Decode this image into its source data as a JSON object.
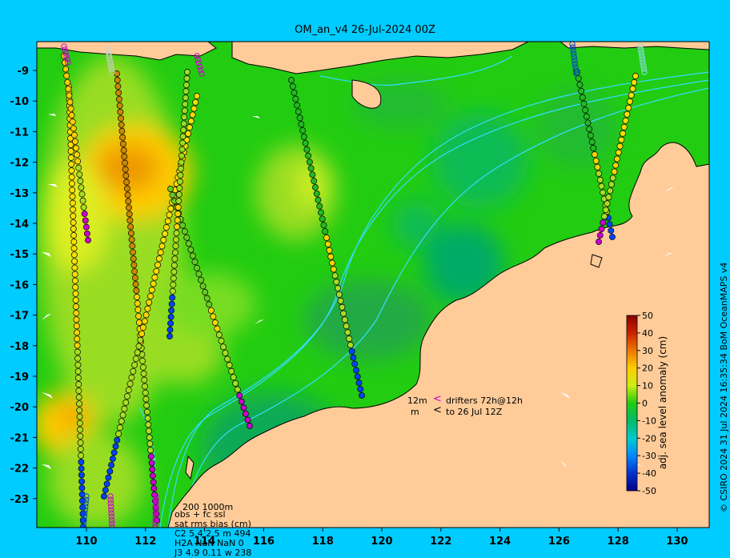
{
  "title": "OM_an_v4  26-Jul-2024 00Z",
  "side_credit": "© CSIRO 2024   31 Jul 2024 16:35:34 BoM OceanMAPS v4",
  "map": {
    "lon_range": [
      109,
      132
    ],
    "lat_range": [
      -24,
      -8
    ],
    "x_ticks": [
      "110",
      "112",
      "114",
      "116",
      "118",
      "120",
      "122",
      "124",
      "126",
      "128",
      "130"
    ],
    "y_ticks": [
      "-9",
      "-10",
      "-11",
      "-12",
      "-13",
      "-14",
      "-15",
      "-16",
      "-17",
      "-18",
      "-19",
      "-20",
      "-21",
      "-22",
      "-23"
    ],
    "colors": {
      "land": "#ffcc99",
      "ocean_base": "#22cc11",
      "contour": "#33ddff",
      "frame": "#00ccff"
    }
  },
  "colorbar": {
    "label": "adj. sea level anomaly (cm)",
    "min": -50,
    "max": 50,
    "ticks": [
      "50",
      "40",
      "30",
      "20",
      "10",
      "0",
      "-10",
      "-20",
      "-30",
      "-40",
      "-50"
    ]
  },
  "drifter_legend": {
    "line1_left": "12m",
    "line1_arrow": "<",
    "line1_text": "drifters 72h@12h",
    "line2_left": "m",
    "line2_arrow": "<",
    "line2_text": "to 26 Jul 12Z"
  },
  "stats": {
    "contours": "200  1000m",
    "line1": "obs + fc ssl",
    "line2": "sat rms bias (cm)",
    "line3": "C2    5.4  2.5 m 494",
    "line4": "H2A   NaN  NaN  0",
    "line5": "J3    4.9  0.11 w 238"
  }
}
